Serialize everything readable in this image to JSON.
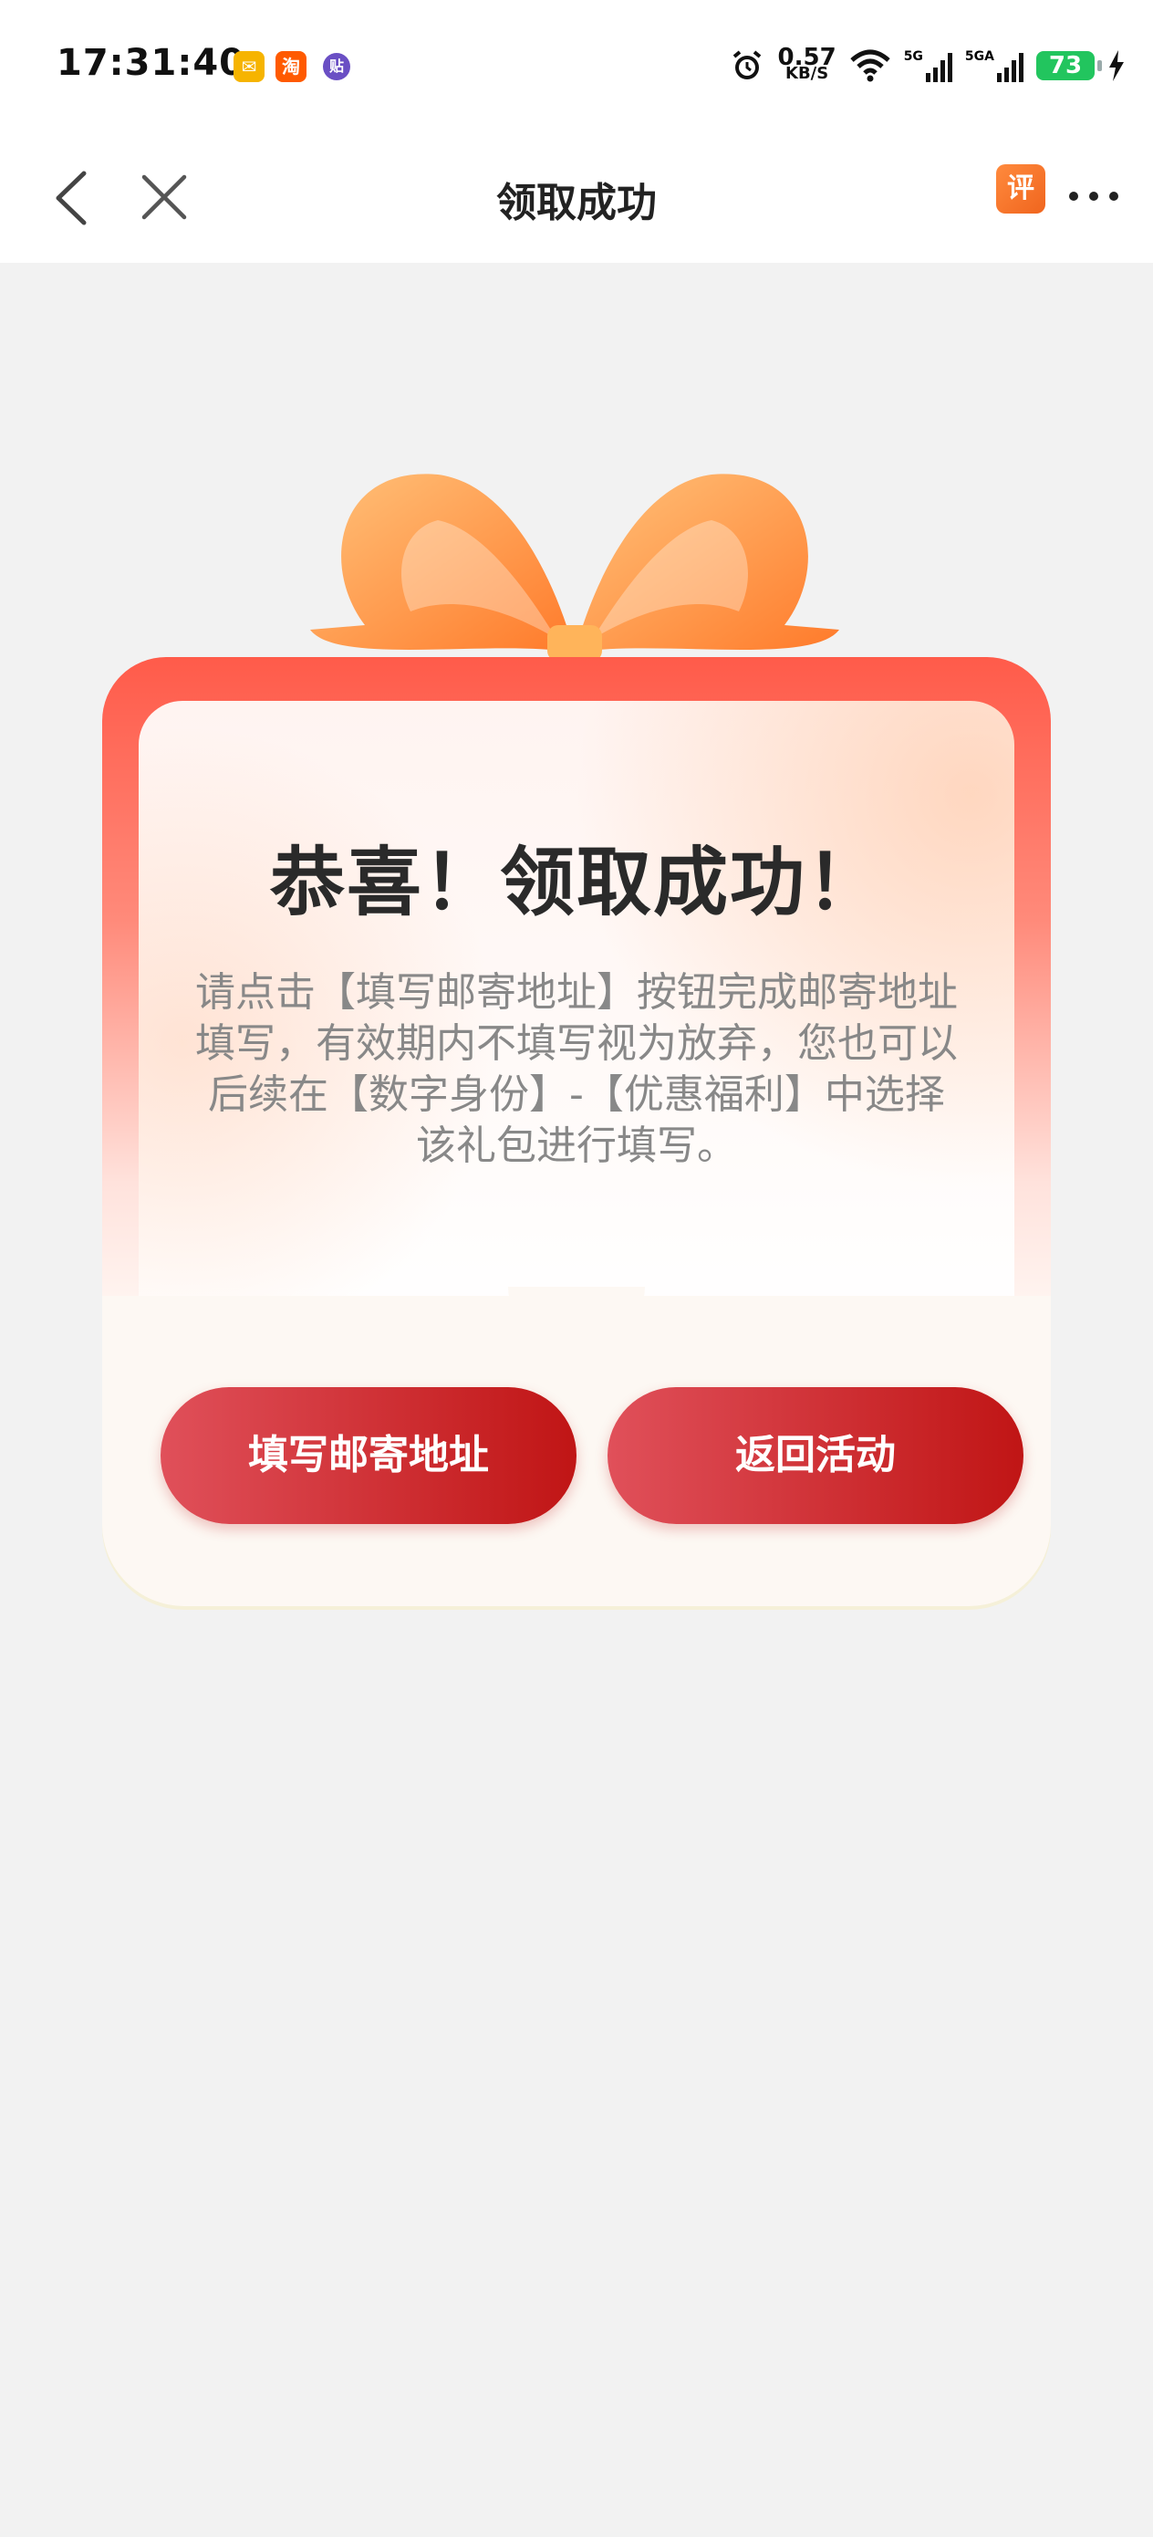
{
  "status_bar": {
    "time": "17:31:40",
    "net_speed_value": "0.57",
    "net_speed_unit": "KB/S",
    "battery": "73",
    "signal_labels": [
      "5G",
      "5GA"
    ]
  },
  "nav": {
    "title": "领取成功",
    "review_icon_label": "评"
  },
  "card": {
    "headline": "恭喜！领取成功！",
    "description": "请点击【填写邮寄地址】按钮完成邮寄地址填写，有效期内不填写视为放弃，您也可以后续在【数字身份】-【优惠福利】中选择该礼包进行填写。",
    "primary_button": "填写邮寄地址",
    "secondary_button": "返回活动"
  },
  "colors": {
    "accent": "#c01515",
    "frame": "#ff5b4a",
    "bow": "#ff9a3c"
  }
}
